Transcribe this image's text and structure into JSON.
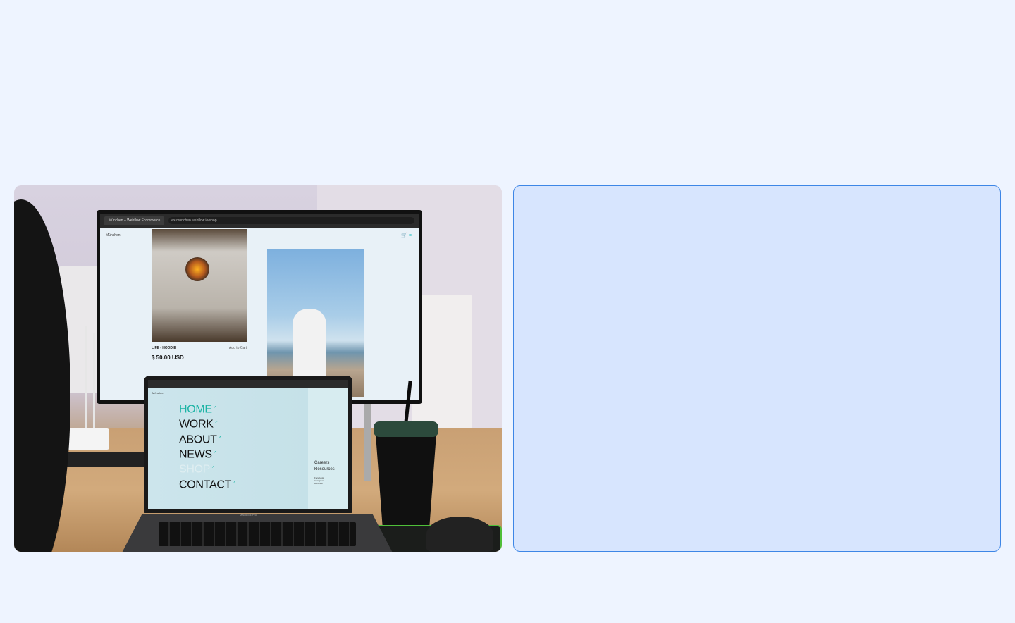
{
  "monitor": {
    "tab_title": "München – Webflow Ecommerce",
    "url": "ex-munchen.webflow.io/shop",
    "site_logo": "München",
    "product_name": "LIFE - HODDIE",
    "add_to_cart": "Add to Cart",
    "price": "$ 50.00 USD"
  },
  "laptop": {
    "site_logo": "München",
    "menu": [
      {
        "label": "HOME",
        "state": "active"
      },
      {
        "label": "WORK",
        "state": "normal"
      },
      {
        "label": "ABOUT",
        "state": "normal"
      },
      {
        "label": "NEWS",
        "state": "normal"
      },
      {
        "label": "SHOP",
        "state": "faded"
      },
      {
        "label": "CONTACT",
        "state": "normal"
      }
    ],
    "side_links": [
      "Careers",
      "Resources"
    ],
    "social_links": [
      "Facebook",
      "Instagram",
      "Behance"
    ],
    "model_label": "MacBook Pro"
  },
  "colors": {
    "page_background": "#eef4ff",
    "panel_fill": "#d7e5fe",
    "panel_border": "#3d86e6",
    "accent_teal": "#19b3a4"
  }
}
